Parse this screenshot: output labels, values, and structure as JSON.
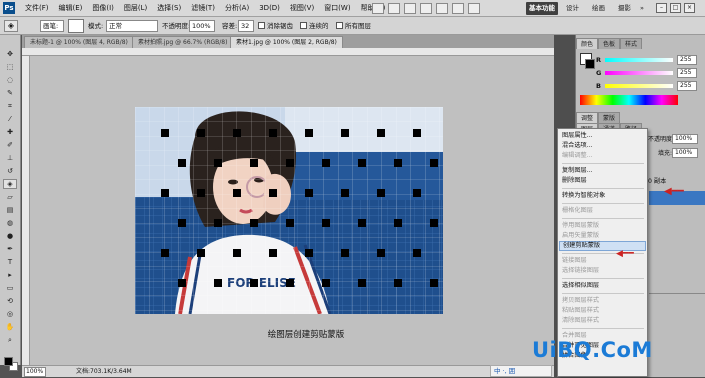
{
  "menu": {
    "logo": "Ps",
    "items": [
      "文件(F)",
      "编辑(E)",
      "图像(I)",
      "图层(L)",
      "选择(S)",
      "滤镜(T)",
      "分析(A)",
      "3D(D)",
      "视图(V)",
      "窗口(W)",
      "帮助(H)"
    ],
    "workspace_active": "基本功能",
    "workspace_links": [
      "设计",
      "绘画",
      "摄影",
      "»"
    ]
  },
  "options": {
    "brush_label": "画笔:",
    "brush_size": "4",
    "mode_label": "模式:",
    "mode_value": "正常",
    "opacity_label": "不透明度:",
    "opacity_value": "100%",
    "tolerance_label": "容差:",
    "tolerance_value": "32",
    "anti_alias_label": "消除锯齿",
    "contiguous_label": "连续的",
    "all_layers_label": "所有图层"
  },
  "tabs": [
    {
      "label": "未标题-1 @ 100% (图层 4, RGB/8)",
      "active": false
    },
    {
      "label": "素材拍照.jpg @ 66.7% (RGB/8)",
      "active": false
    },
    {
      "label": "素材1.jpg @ 100% (图层 2, RGB/8)",
      "active": true
    }
  ],
  "canvas": {
    "caption": "绘图层创建剪贴蒙版"
  },
  "status": {
    "zoom": "100%",
    "doc_info": "文档:703.1K/3.64M"
  },
  "color_panel": {
    "tabs": [
      "颜色",
      "色板",
      "样式"
    ],
    "r_label": "R",
    "r_value": "255",
    "g_label": "G",
    "g_value": "255",
    "b_label": "B",
    "b_value": "255"
  },
  "layers_panel": {
    "tabs": [
      "调整",
      "蒙版"
    ],
    "tabs2": [
      "图层",
      "通道",
      "路径"
    ],
    "opacity_label": "不透明度:",
    "opacity_value": "100%",
    "fill_label": "填充:",
    "fill_value": "100%",
    "layer_suffix": "0 副本"
  },
  "context_menu": [
    {
      "label": "图层属性...",
      "state": "normal"
    },
    {
      "label": "混合选项...",
      "state": "normal"
    },
    {
      "label": "编辑调整...",
      "state": "disabled"
    },
    {
      "sep": true
    },
    {
      "label": "复制图层...",
      "state": "normal"
    },
    {
      "label": "删除图层",
      "state": "normal"
    },
    {
      "sep": true
    },
    {
      "label": "转换为智能对象",
      "state": "normal"
    },
    {
      "sep": true
    },
    {
      "label": "栅格化图层",
      "state": "disabled"
    },
    {
      "sep": true
    },
    {
      "label": "停用图层蒙版",
      "state": "disabled"
    },
    {
      "label": "启用矢量蒙版",
      "state": "disabled"
    },
    {
      "label": "创建剪贴蒙版",
      "state": "highlighted"
    },
    {
      "sep": true
    },
    {
      "label": "链接图层",
      "state": "disabled"
    },
    {
      "label": "选择链接图层",
      "state": "disabled"
    },
    {
      "sep": true
    },
    {
      "label": "选择相似图层",
      "state": "normal"
    },
    {
      "sep": true
    },
    {
      "label": "拷贝图层样式",
      "state": "disabled"
    },
    {
      "label": "粘贴图层样式",
      "state": "disabled"
    },
    {
      "label": "清除图层样式",
      "state": "disabled"
    },
    {
      "sep": true
    },
    {
      "label": "合并图层",
      "state": "disabled"
    },
    {
      "label": "合并可见图层",
      "state": "normal"
    },
    {
      "label": "拼合图像",
      "state": "normal"
    }
  ],
  "watermark": "UiBQ.CoM",
  "ime": "中 ·, 囲",
  "colors": {
    "accent": "#1b7bd6",
    "arrow": "#cc2222",
    "selected_layer": "#3a77c2"
  }
}
